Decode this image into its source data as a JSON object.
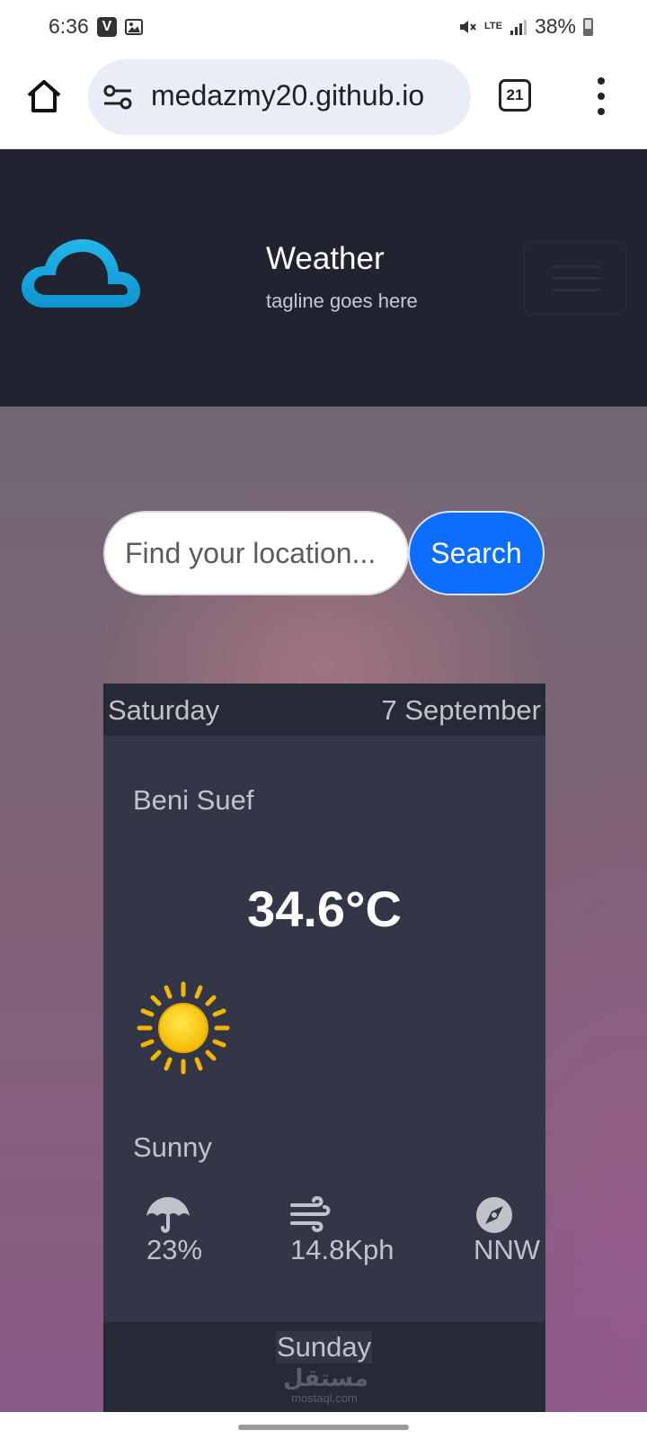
{
  "status_bar": {
    "time": "6:36",
    "notif_v": "V",
    "battery": "38%",
    "network": "LTE"
  },
  "browser": {
    "url": "medazmy20.github.io",
    "tab_count": "21"
  },
  "header": {
    "title": "Weather",
    "tagline": "tagline goes here"
  },
  "search": {
    "placeholder": "Find your location...",
    "button_label": "Search"
  },
  "today": {
    "day": "Saturday",
    "date": "7 September",
    "location": "Beni Suef",
    "temperature": "34.6°C",
    "condition": "Sunny",
    "condition_icon": "sun-icon",
    "humidity": "23%",
    "wind_speed": "14.8Kph",
    "wind_direction": "NNW"
  },
  "next": {
    "day": "Sunday"
  },
  "watermark": {
    "arabic": "مستقل",
    "latin": "mostaql.com"
  },
  "colors": {
    "header_bg": "#212330",
    "card_bg": "#323646",
    "card_head_bg": "#262936",
    "accent": "#0d6efd",
    "logo": "#1ba9e0"
  }
}
